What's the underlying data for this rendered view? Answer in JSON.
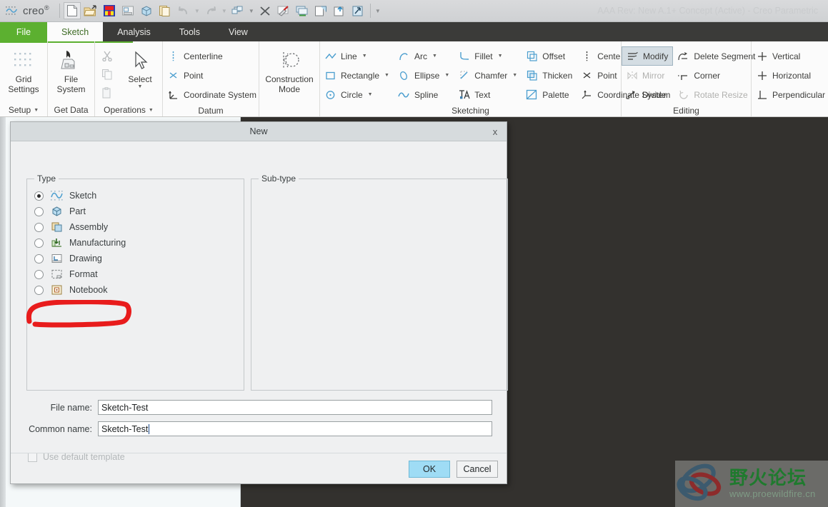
{
  "window": {
    "title": "AAA Rev: New A.1+ Concept  (Active) - Creo Parametric",
    "app_name": "creo",
    "app_name_sup": "®"
  },
  "quick_access": {
    "buttons": [
      {
        "name": "new-file-icon",
        "label": "New"
      },
      {
        "name": "open-file-icon",
        "label": "Open"
      },
      {
        "name": "save-icon",
        "label": "Save"
      },
      {
        "name": "print-icon",
        "label": "Print"
      },
      {
        "name": "part-cube-icon",
        "label": "Part"
      },
      {
        "name": "copy-page-icon",
        "label": "Copy"
      },
      {
        "name": "undo-icon",
        "label": "Undo"
      },
      {
        "name": "redo-icon",
        "label": "Redo"
      },
      {
        "name": "regenerate-icon",
        "label": "Regenerate"
      },
      {
        "name": "close-window-icon",
        "label": "Close"
      },
      {
        "name": "paint-icon",
        "label": "Appearance"
      },
      {
        "name": "display-style-icon",
        "label": "Display Style"
      },
      {
        "name": "new-window-icon",
        "label": "New Window"
      },
      {
        "name": "refresh-window-icon",
        "label": "Refresh"
      },
      {
        "name": "sketch-view-icon",
        "label": "Sketch View"
      },
      {
        "name": "customize-toolbar-icon",
        "label": "Customize"
      }
    ]
  },
  "tabs": [
    {
      "label": "File",
      "active": false,
      "style": "file"
    },
    {
      "label": "Sketch",
      "active": true,
      "style": "normal"
    },
    {
      "label": "Analysis",
      "active": false,
      "style": "normal"
    },
    {
      "label": "Tools",
      "active": false,
      "style": "normal"
    },
    {
      "label": "View",
      "active": false,
      "style": "normal"
    }
  ],
  "ribbon": {
    "groups": [
      {
        "label": "Setup",
        "has_dropdown": true,
        "big_buttons": [
          {
            "label": "Grid\nSettings",
            "icon": "grid-settings-icon"
          }
        ]
      },
      {
        "label": "Get Data",
        "has_dropdown": false,
        "big_buttons": [
          {
            "label": "File\nSystem",
            "icon": "file-system-icon"
          }
        ]
      },
      {
        "label": "Operations",
        "has_dropdown": true,
        "icon_column": [
          {
            "name": "cut-icon",
            "disabled": true
          },
          {
            "name": "copy-icon",
            "disabled": true
          },
          {
            "name": "paste-icon",
            "disabled": true
          }
        ],
        "big_buttons": [
          {
            "label": "Select",
            "icon": "select-arrow-icon",
            "has_dropdown": true
          }
        ]
      },
      {
        "label": "Datum",
        "has_dropdown": false,
        "small_buttons": [
          {
            "label": "Centerline",
            "icon": "centerline-icon"
          },
          {
            "label": "Point",
            "icon": "point-icon"
          },
          {
            "label": "Coordinate System",
            "icon": "coordinate-system-icon"
          }
        ]
      },
      {
        "label": "",
        "has_dropdown": false,
        "big_buttons": [
          {
            "label": "Construction\nMode",
            "icon": "construction-mode-icon"
          }
        ]
      },
      {
        "label": "Sketching",
        "has_dropdown": false,
        "columns": [
          [
            {
              "label": "Line",
              "icon": "line-icon",
              "dropdown": true
            },
            {
              "label": "Rectangle",
              "icon": "rectangle-icon",
              "dropdown": true
            },
            {
              "label": "Circle",
              "icon": "circle-icon",
              "dropdown": true
            }
          ],
          [
            {
              "label": "Arc",
              "icon": "arc-icon",
              "dropdown": true
            },
            {
              "label": "Ellipse",
              "icon": "ellipse-icon",
              "dropdown": true
            },
            {
              "label": "Spline",
              "icon": "spline-icon",
              "dropdown": false
            }
          ],
          [
            {
              "label": "Fillet",
              "icon": "fillet-icon",
              "dropdown": true
            },
            {
              "label": "Chamfer",
              "icon": "chamfer-icon",
              "dropdown": true
            },
            {
              "label": "Text",
              "icon": "text-icon",
              "dropdown": false
            }
          ],
          [
            {
              "label": "Offset",
              "icon": "offset-icon",
              "dropdown": false
            },
            {
              "label": "Thicken",
              "icon": "thicken-icon",
              "dropdown": false
            },
            {
              "label": "Palette",
              "icon": "palette-icon",
              "dropdown": false
            }
          ],
          [
            {
              "label": "Centerline",
              "icon": "centerline-icon",
              "dropdown": true
            },
            {
              "label": "Point",
              "icon": "point-icon",
              "dropdown": false
            },
            {
              "label": "Coordinate System",
              "icon": "coordinate-system-icon",
              "dropdown": false
            }
          ]
        ]
      },
      {
        "label": "Editing",
        "has_dropdown": false,
        "columns": [
          [
            {
              "label": "Modify",
              "icon": "modify-icon",
              "selected": true
            },
            {
              "label": "Mirror",
              "icon": "mirror-icon",
              "disabled": true
            },
            {
              "label": "Divide",
              "icon": "divide-icon"
            }
          ],
          [
            {
              "label": "Delete Segment",
              "icon": "delete-segment-icon"
            },
            {
              "label": "Corner",
              "icon": "corner-icon"
            },
            {
              "label": "Rotate Resize",
              "icon": "rotate-resize-icon",
              "disabled": true
            }
          ]
        ]
      },
      {
        "label": "",
        "has_dropdown": false,
        "columns": [
          [
            {
              "label": "Vertical",
              "icon": "vertical-constraint-icon"
            },
            {
              "label": "Horizontal",
              "icon": "horizontal-constraint-icon"
            },
            {
              "label": "Perpendicular",
              "icon": "perpendicular-constraint-icon"
            }
          ]
        ]
      }
    ]
  },
  "dialog": {
    "title": "New",
    "close_label": "x",
    "type_group_label": "Type",
    "subtype_group_label": "Sub-type",
    "types": [
      {
        "label": "Sketch",
        "icon": "sketch-type-icon",
        "selected": true,
        "annotated": true
      },
      {
        "label": "Part",
        "icon": "part-type-icon",
        "selected": false
      },
      {
        "label": "Assembly",
        "icon": "assembly-type-icon",
        "selected": false
      },
      {
        "label": "Manufacturing",
        "icon": "manufacturing-type-icon",
        "selected": false
      },
      {
        "label": "Drawing",
        "icon": "drawing-type-icon",
        "selected": false
      },
      {
        "label": "Format",
        "icon": "format-type-icon",
        "selected": false
      },
      {
        "label": "Notebook",
        "icon": "notebook-type-icon",
        "selected": false
      }
    ],
    "file_name_label": "File name:",
    "file_name_value": "Sketch-Test",
    "common_name_label": "Common name:",
    "common_name_value": "Sketch-Test",
    "use_default_template_label": "Use default template",
    "use_default_template_checked": false,
    "use_default_template_disabled": true,
    "ok_label": "OK",
    "cancel_label": "Cancel",
    "annotation_color": "#e81c1c"
  },
  "watermark": {
    "forum_name": "野火论坛",
    "url": "www.proewildfire.cn"
  },
  "colors": {
    "accent_green": "#5cb030",
    "ribbon_bg": "#fbfbfb",
    "tab_bg": "#3b3b39",
    "graphics_bg": "#33312e",
    "dialog_bg": "#eff0f1",
    "primary_button": "#9fdcf5",
    "annotation_red": "#e81c1c",
    "icon_blue": "#4b9ecf"
  }
}
